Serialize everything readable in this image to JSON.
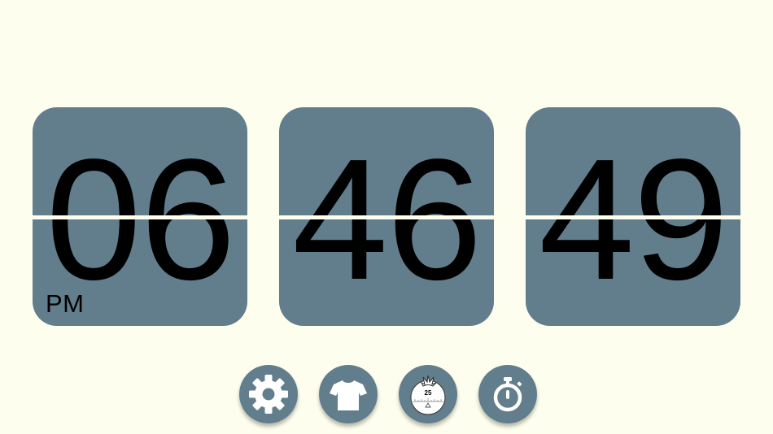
{
  "clock": {
    "hours": "06",
    "minutes": "46",
    "seconds": "49",
    "period": "PM"
  },
  "toolbar": {
    "buttons": [
      {
        "id": "settings",
        "icon": "gear-icon"
      },
      {
        "id": "theme",
        "icon": "tshirt-icon"
      },
      {
        "id": "pomodoro",
        "icon": "tomato-timer-icon",
        "label": "25"
      },
      {
        "id": "stopwatch",
        "icon": "stopwatch-icon"
      }
    ]
  },
  "colors": {
    "background": "#fdfeee",
    "card": "#627e8c",
    "digits": "#000000",
    "icon": "#ffffff"
  }
}
